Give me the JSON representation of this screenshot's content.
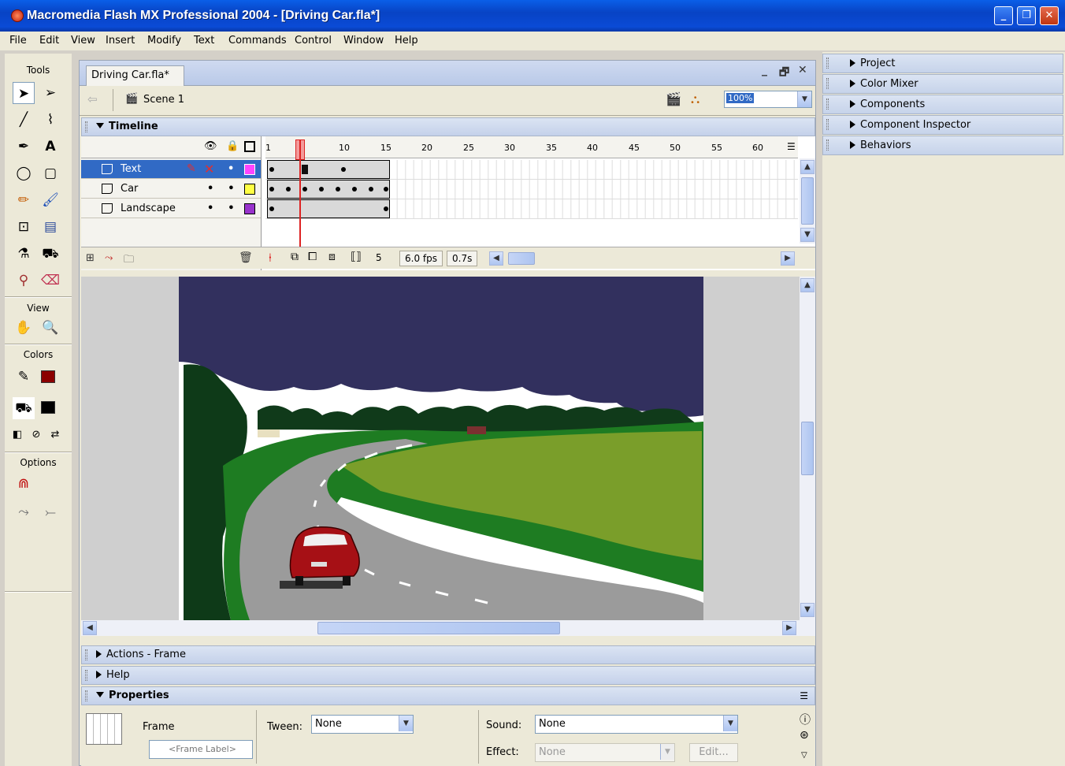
{
  "window": {
    "title": "Macromedia Flash MX Professional 2004 - [Driving Car.fla*]"
  },
  "menu": [
    "File",
    "Edit",
    "View",
    "Insert",
    "Modify",
    "Text",
    "Commands",
    "Control",
    "Window",
    "Help"
  ],
  "tools": {
    "label": "Tools",
    "view_label": "View",
    "colors_label": "Colors",
    "options_label": "Options",
    "stroke_color": "#8b0000",
    "fill_color": "#000000"
  },
  "document": {
    "tab": "Driving Car.fla*",
    "scene": "Scene 1",
    "zoom": "100%"
  },
  "timeline": {
    "title": "Timeline",
    "ruler": [
      "1",
      "5",
      "10",
      "15",
      "20",
      "25",
      "30",
      "35",
      "40",
      "45",
      "50",
      "55",
      "60"
    ],
    "layers": [
      {
        "name": "Text",
        "color": "#ff44ff"
      },
      {
        "name": "Car",
        "color": "#ffff44"
      },
      {
        "name": "Landscape",
        "color": "#9933cc"
      }
    ],
    "current_frame": "5",
    "fps": "6.0 fps",
    "elapsed": "0.7s"
  },
  "panels": {
    "actions": "Actions - Frame",
    "help": "Help",
    "properties": "Properties"
  },
  "properties": {
    "frame_label": "Frame",
    "frame_placeholder": "<Frame Label>",
    "tween_label": "Tween:",
    "tween_value": "None",
    "sound_label": "Sound:",
    "sound_value": "None",
    "effect_label": "Effect:",
    "effect_value": "None",
    "edit_button": "Edit..."
  },
  "right_panels": [
    "Project",
    "Color Mixer",
    "Components",
    "Component Inspector",
    "Behaviors"
  ]
}
